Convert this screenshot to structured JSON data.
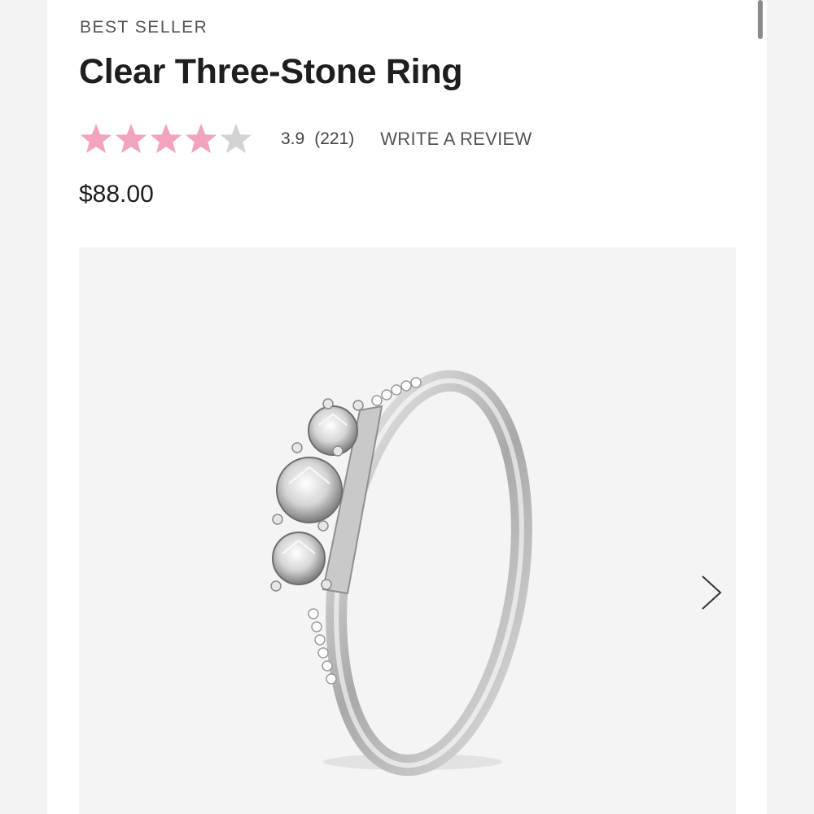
{
  "product": {
    "badge": "BEST SELLER",
    "title": "Clear Three-Stone Ring",
    "price": "$88.00"
  },
  "rating": {
    "value": "3.9",
    "count": "(221)",
    "stars_filled": 4,
    "stars_total": 5,
    "write_review_label": "WRITE A REVIEW"
  },
  "colors": {
    "star_filled": "#f2a3bd",
    "star_empty": "#d3d3d3"
  },
  "gallery": {
    "icons": {
      "next": "chevron-right-icon"
    }
  }
}
